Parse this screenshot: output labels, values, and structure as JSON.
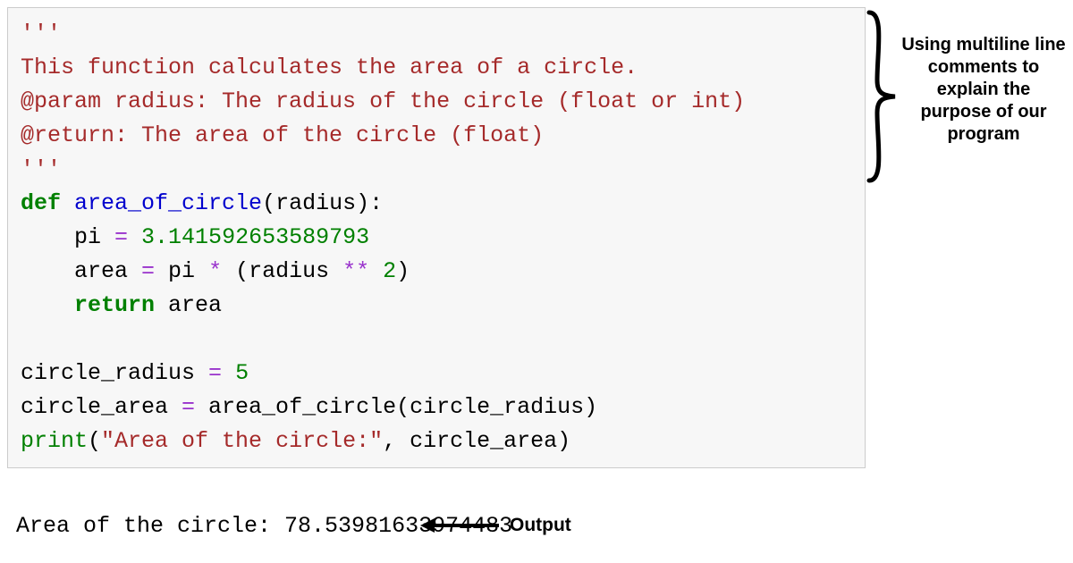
{
  "code": {
    "line1": "'''",
    "line2": "This function calculates the area of a circle.",
    "line3": "@param radius: The radius of the circle (float or int)",
    "line4": "@return: The area of the circle (float)",
    "line5": "'''",
    "def": "def",
    "funcname": " area_of_circle",
    "defparen_open": "(",
    "param_radius": "radius",
    "defparen_close": "):",
    "indent": "    ",
    "pi_var": "pi ",
    "eq1": "=",
    "pi_val": " 3.141592653589793",
    "area_var": "area ",
    "eq2": "=",
    "expr_pi": " pi ",
    "star": "*",
    "expr_paren_open": " (",
    "expr_radius": "radius ",
    "dstar": "**",
    "expr_two": " 2",
    "expr_paren_close": ")",
    "return_kw": "return",
    "return_var": " area",
    "blank": "",
    "cr_var": "circle_radius ",
    "eq3": "=",
    "cr_val": " 5",
    "ca_var": "circle_area ",
    "eq4": "=",
    "ca_call": " area_of_circle(circle_radius)",
    "print_kw": "print",
    "print_open": "(",
    "print_str": "\"Area of the circle:\"",
    "print_rest": ", circle_area)"
  },
  "output": {
    "text": "Area of the circle: 78.53981633974483"
  },
  "annotations": {
    "comment_label": "Using multiline line comments to explain the purpose of our program",
    "output_label": "Output"
  }
}
